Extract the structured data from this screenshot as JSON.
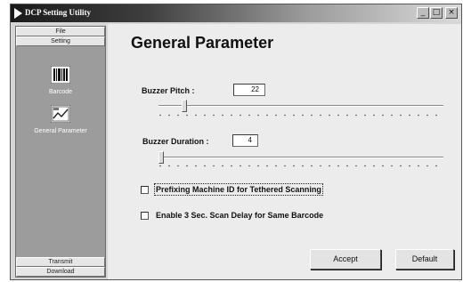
{
  "window": {
    "title": "DCP Setting Utility",
    "controls": {
      "minimize": "_",
      "maximize": "□",
      "close": "×"
    }
  },
  "nav": {
    "file": "File",
    "setting": "Setting",
    "items": [
      {
        "label": "Barcode",
        "icon": "barcode-icon"
      },
      {
        "label": "General Parameter",
        "icon": "general-parameter-icon"
      }
    ],
    "transmit": "Transmit",
    "download": "Download"
  },
  "main": {
    "title": "General Parameter",
    "buzzer_pitch": {
      "label": "Buzzer Pitch  :",
      "value": "22",
      "level": 0.1
    },
    "buzzer_duration": {
      "label": "Buzzer Duration  :",
      "value": "4",
      "level": 0.0
    },
    "options": [
      {
        "label": "Prefixing Machine ID for Tethered Scanning",
        "checked": false
      },
      {
        "label": "Enable 3 Sec. Scan Delay for Same Barcode",
        "checked": false
      }
    ],
    "accept_label": "Accept",
    "default_label": "Default"
  }
}
